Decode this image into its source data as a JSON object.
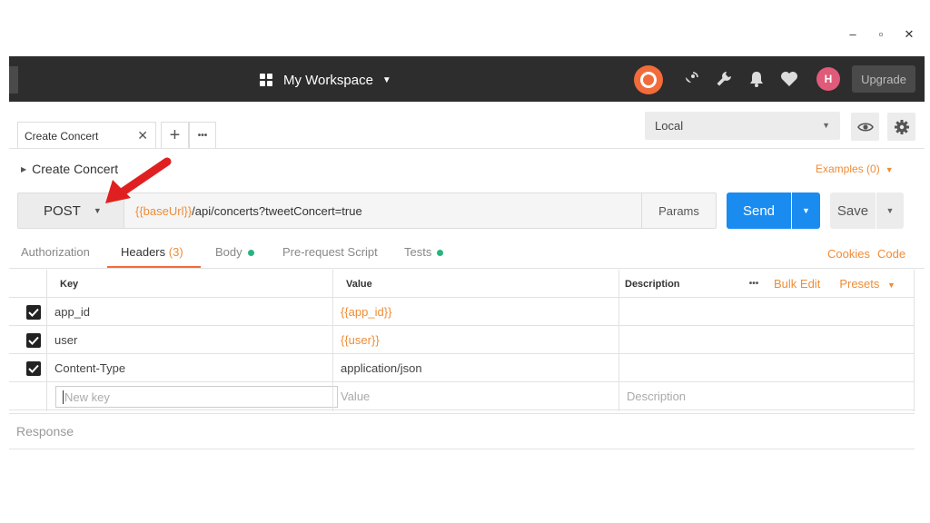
{
  "window_controls": {
    "minimize": "–",
    "maximize": "▫",
    "close": "✕"
  },
  "topbar": {
    "workspace": "My Workspace",
    "upgrade_label": "Upgrade",
    "avatar_initial": "H"
  },
  "tabs": {
    "active_label": "Create Concert",
    "new_tab": "+",
    "more": "•••"
  },
  "environment": {
    "selected": "Local"
  },
  "request": {
    "title": "Create Concert",
    "examples_label": "Examples (0)",
    "method": "POST",
    "url_var": "{{baseUrl}}",
    "url_path": "/api/concerts?tweetConcert=true",
    "params_label": "Params",
    "send_label": "Send",
    "save_label": "Save"
  },
  "subtabs": {
    "authorization": "Authorization",
    "headers": "Headers",
    "headers_count": "(3)",
    "body": "Body",
    "prerequest": "Pre-request Script",
    "tests": "Tests",
    "cookies": "Cookies",
    "code": "Code"
  },
  "table": {
    "col_key": "Key",
    "col_value": "Value",
    "col_description": "Description",
    "more": "•••",
    "bulk_edit": "Bulk Edit",
    "presets": "Presets",
    "rows": [
      {
        "key": "app_id",
        "value": "{{app_id}}",
        "checked": true
      },
      {
        "key": "user",
        "value": "{{user}}",
        "checked": true
      },
      {
        "key": "Content-Type",
        "value": "application/json",
        "checked": true
      }
    ],
    "new_key_placeholder": "New key",
    "new_value_placeholder": "Value",
    "new_description_placeholder": "Description"
  },
  "response_label": "Response",
  "colors": {
    "accent_orange": "#f08c36",
    "send_blue": "#1a8cf0",
    "topbar_dark": "#2d2d2d",
    "annotation_red": "#e02020",
    "dot_green": "#26b47f"
  }
}
